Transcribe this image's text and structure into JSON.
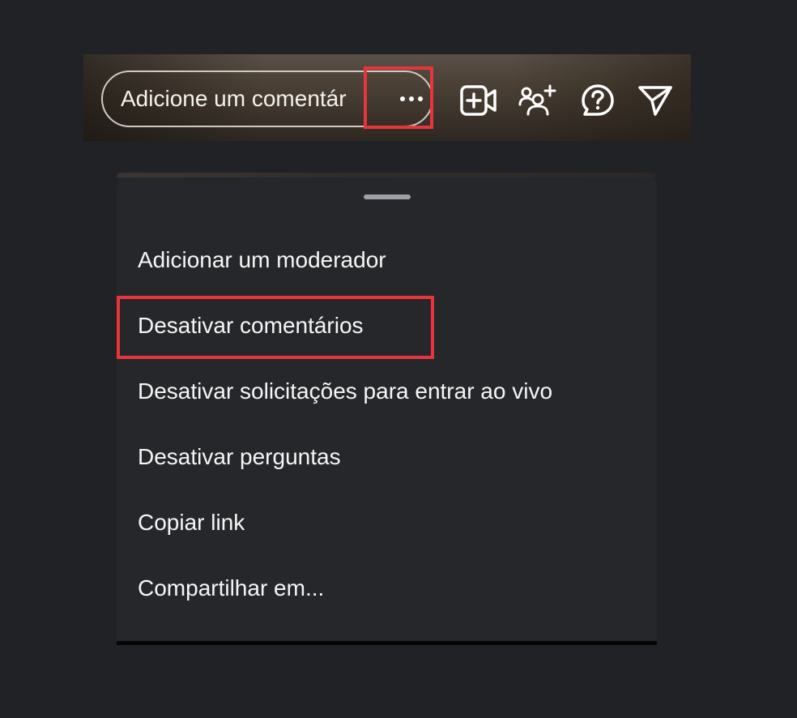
{
  "comment_bar": {
    "placeholder": "Adicione um comentár",
    "more_label": "···",
    "icons": [
      "video-add-icon",
      "add-people-icon",
      "question-icon",
      "send-icon"
    ]
  },
  "sheet": {
    "menu": [
      {
        "id": "add-moderator",
        "label": "Adicionar um moderador"
      },
      {
        "id": "disable-comments",
        "label": "Desativar comentários"
      },
      {
        "id": "disable-live-requests",
        "label": "Desativar solicitações para entrar ao vivo"
      },
      {
        "id": "disable-questions",
        "label": "Desativar perguntas"
      },
      {
        "id": "copy-link",
        "label": "Copiar link"
      },
      {
        "id": "share",
        "label": "Compartilhar em..."
      }
    ]
  },
  "colors": {
    "highlight": "#e8353b",
    "sheet_bg": "#25272b",
    "page_bg": "#212226"
  }
}
